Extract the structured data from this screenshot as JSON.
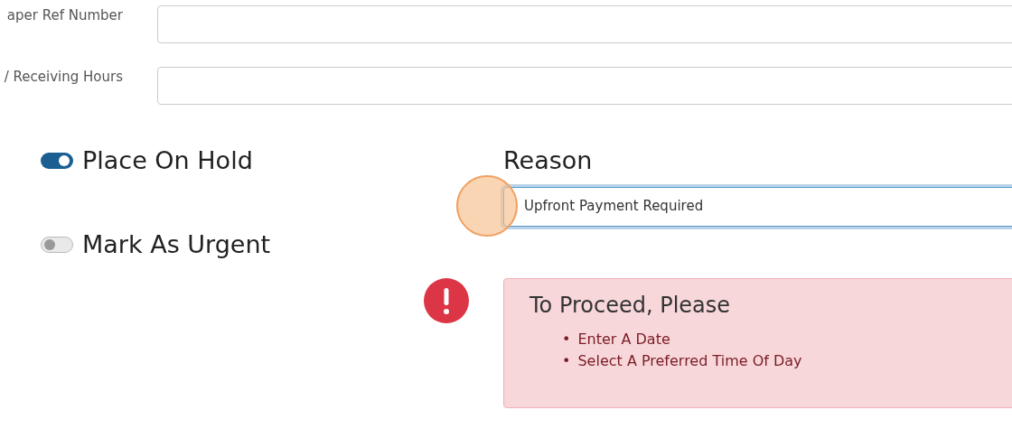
{
  "form_fields": [
    {
      "label": "aper Ref Number"
    },
    {
      "label": "/ Receiving Hours"
    }
  ],
  "switches": [
    {
      "label": "Place On Hold",
      "on": true
    },
    {
      "label": "Mark As Urgent",
      "on": false
    }
  ],
  "reason": {
    "label": "Reason",
    "value": "Upfront Payment Required",
    "focused": true,
    "click_highlight": true
  },
  "alert": {
    "title": "To Proceed, Please",
    "items": [
      {
        "bullet": "•",
        "text": "Enter A Date"
      },
      {
        "bullet": "•",
        "text": "Select A Preferred Time Of Day"
      }
    ]
  }
}
